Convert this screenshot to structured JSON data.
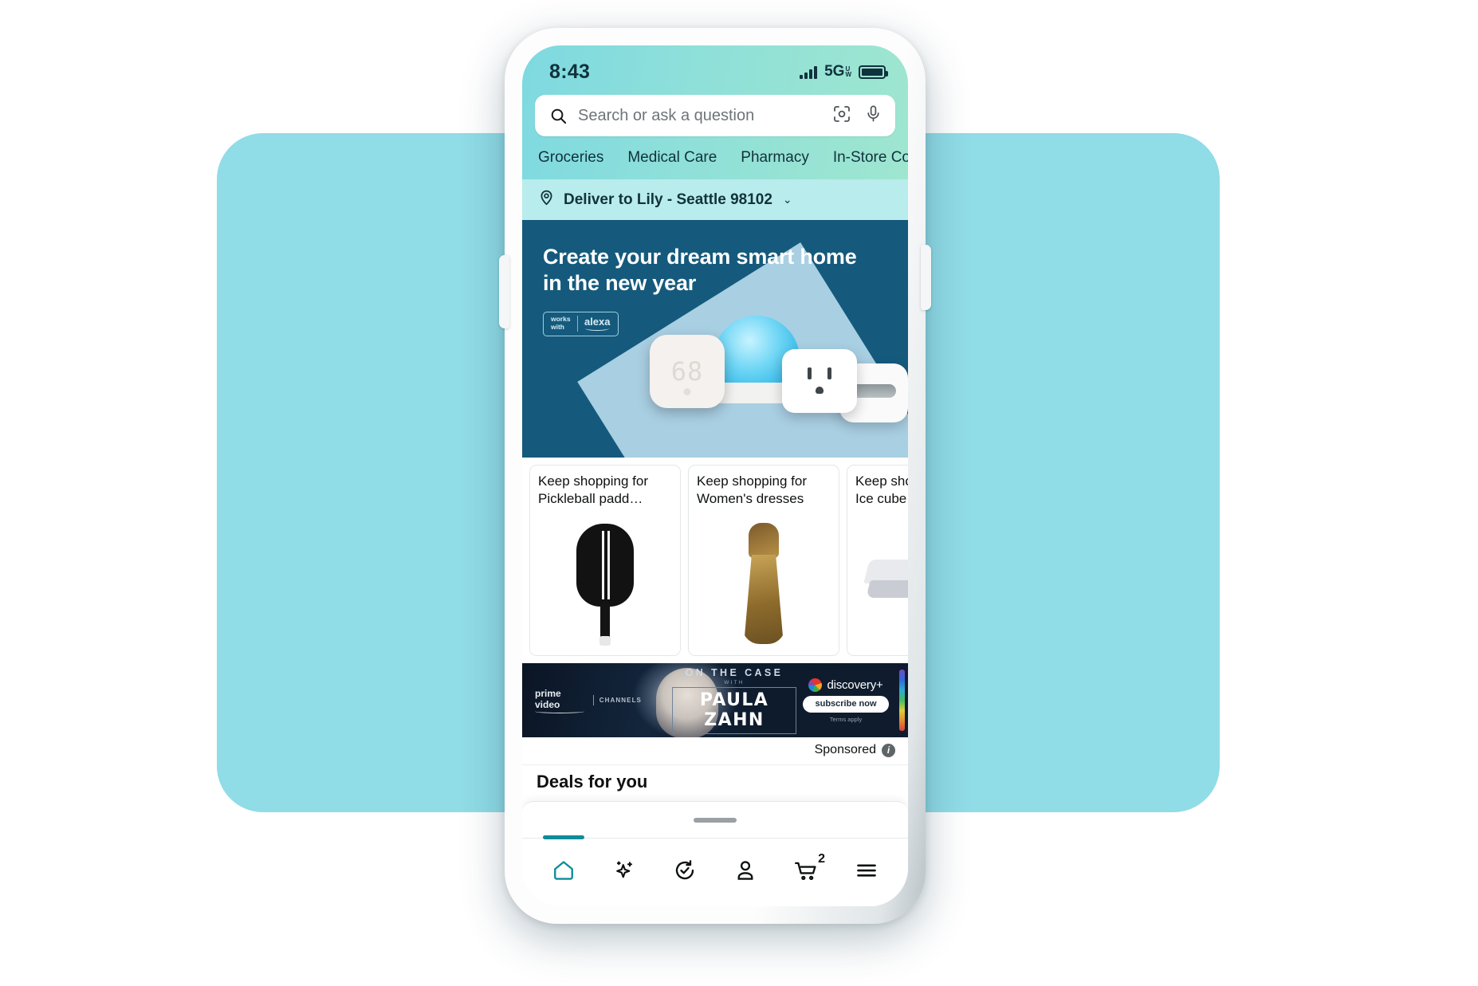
{
  "status_bar": {
    "time": "8:43",
    "network": "5G",
    "network_sub_top": "U",
    "network_sub_bottom": "W",
    "signal_icon": "signal-bars-icon",
    "battery_icon": "battery-full-icon"
  },
  "search": {
    "placeholder": "Search or ask a question",
    "search_icon": "search-icon",
    "camera_icon": "camera-lens-scan-icon",
    "mic_icon": "microphone-icon"
  },
  "categories": [
    {
      "label": "Groceries"
    },
    {
      "label": "Medical Care"
    },
    {
      "label": "Pharmacy"
    },
    {
      "label": "In-Store Cou"
    }
  ],
  "delivery": {
    "pin_icon": "location-pin-icon",
    "text": "Deliver to Lily - Seattle 98102",
    "chevron": "⌄"
  },
  "hero": {
    "title_line1": "Create your dream smart home",
    "title_line2": "in the new year",
    "badge_works": "works",
    "badge_with": "with",
    "badge_alexa": "alexa",
    "thermostat_temp": "68",
    "bg_color": "#155a7c",
    "wedge_color": "#a9cfe3"
  },
  "cards": [
    {
      "title_line1": "Keep shopping for",
      "title_line2": "Pickleball padd…",
      "image": "pickleball-paddle"
    },
    {
      "title_line1": "Keep shopping for",
      "title_line2": "Women's dresses",
      "image": "gold-dress"
    },
    {
      "title_line1": "Keep shoppin",
      "title_line2": "Ice cube mold",
      "image": "ice-cube-tray"
    }
  ],
  "ad": {
    "prime_video": "prime video",
    "channels": "CHANNELS",
    "on_the_case": "ON THE CASE",
    "with": "WITH",
    "talent": "PAULA ZAHN",
    "brand": "discovery+",
    "cta": "subscribe now",
    "terms": "Terms apply",
    "sponsored_label": "Sponsored",
    "info_icon": "info-icon"
  },
  "next_section": {
    "heading": "Deals for you"
  },
  "bottom_nav": {
    "items": [
      {
        "name": "home",
        "icon": "home-icon",
        "active": true
      },
      {
        "name": "rufus",
        "icon": "sparkle-ai-icon",
        "active": false
      },
      {
        "name": "buy-again",
        "icon": "refresh-check-icon",
        "active": false
      },
      {
        "name": "account",
        "icon": "person-icon",
        "active": false
      },
      {
        "name": "cart",
        "icon": "shopping-cart-icon",
        "active": false,
        "badge": "2"
      },
      {
        "name": "menu",
        "icon": "hamburger-menu-icon",
        "active": false
      }
    ],
    "active_color": "#0f8c99"
  },
  "theme": {
    "backdrop": "#90dce7",
    "header_gradient_start": "#7ed9e0",
    "header_gradient_end": "#9fe6cf",
    "deliver_bar": "#b9ecec"
  }
}
